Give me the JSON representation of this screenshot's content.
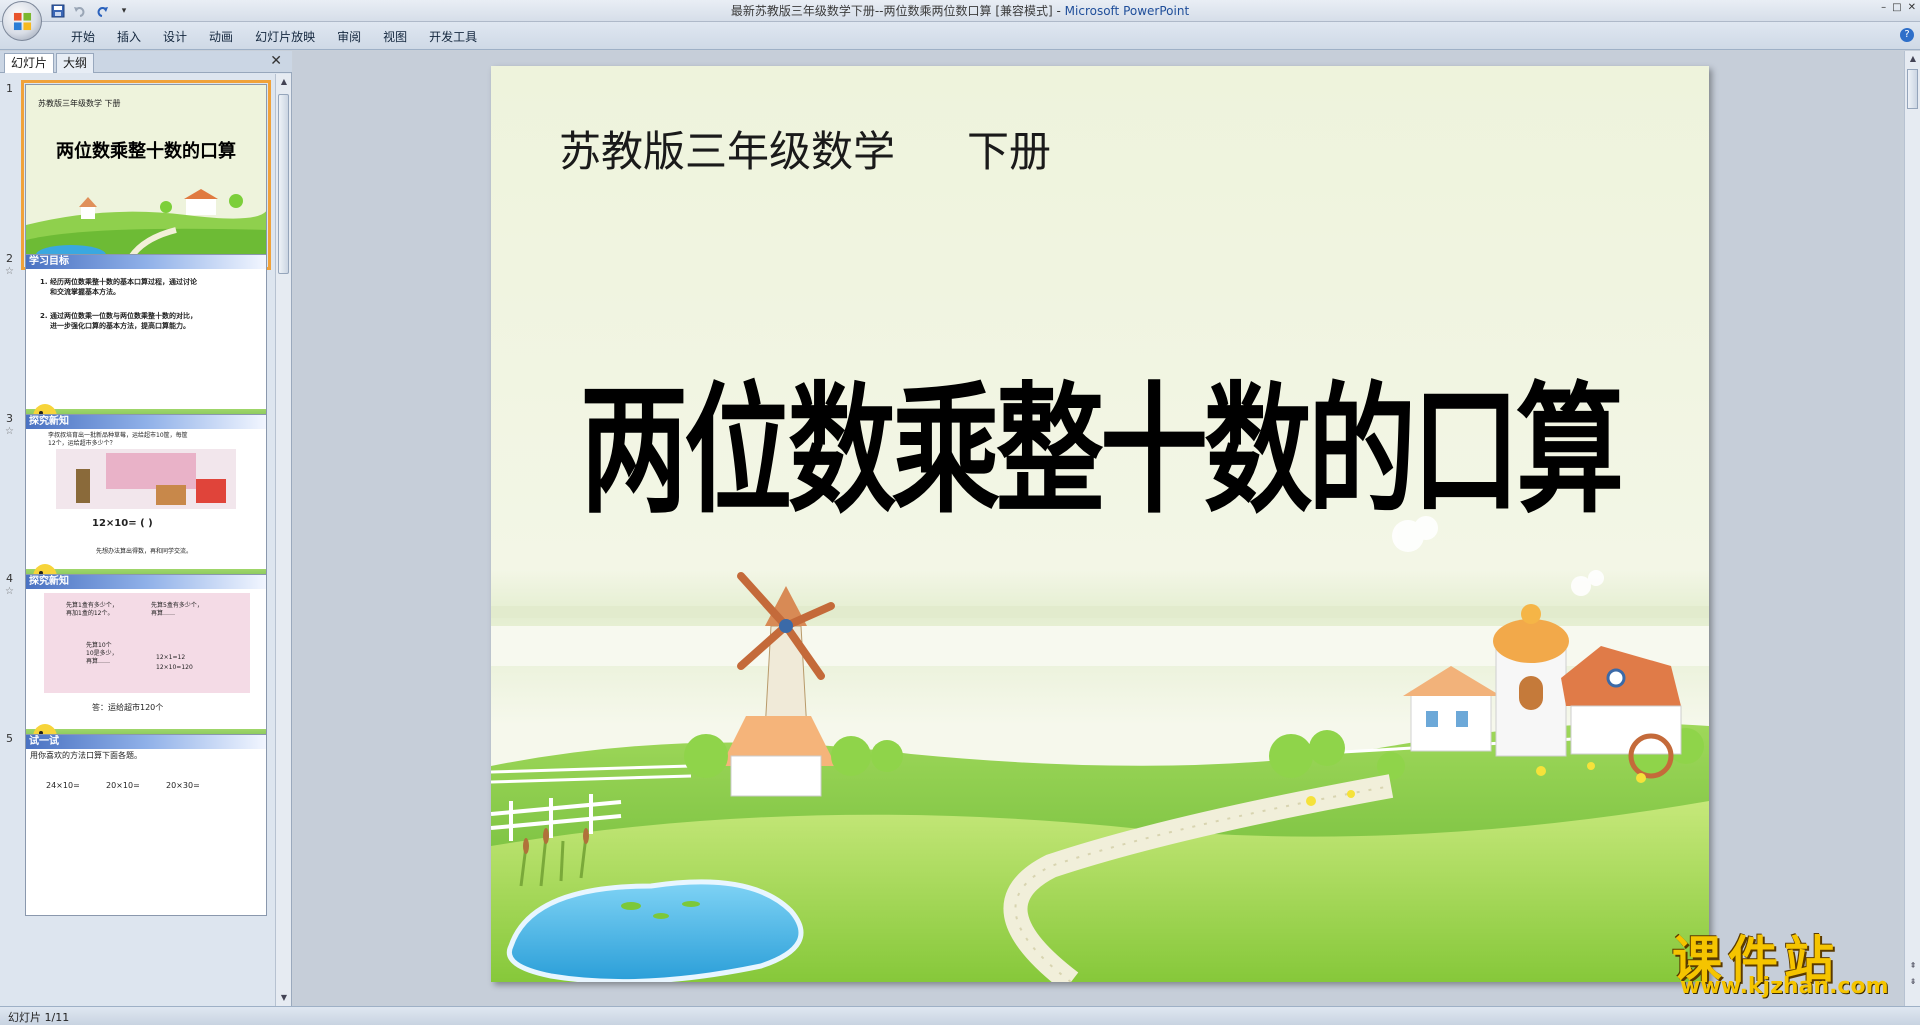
{
  "window": {
    "title_doc": "最新苏教版三年级数学下册--两位数乘两位数口算 [兼容模式]",
    "title_sep": " - ",
    "title_app": "Microsoft PowerPoint",
    "controls": [
      "–",
      "□",
      "✕"
    ]
  },
  "quick_access": [
    {
      "name": "save-icon",
      "glyph": "💾"
    },
    {
      "name": "undo-icon",
      "glyph": "↶"
    },
    {
      "name": "redo-icon",
      "glyph": "↻"
    },
    {
      "name": "customize-icon",
      "glyph": "▾"
    }
  ],
  "ribbon": {
    "tabs": [
      "开始",
      "插入",
      "设计",
      "动画",
      "幻灯片放映",
      "审阅",
      "视图",
      "开发工具"
    ],
    "help": "?"
  },
  "left_pane": {
    "tab_slides": "幻灯片",
    "tab_outline": "大纲",
    "close": "✕",
    "thumbnails": [
      {
        "num": "1",
        "subtitle": "苏教版三年级数学      下册",
        "title": "两位数乘整十数的口算"
      },
      {
        "num": "2",
        "header": "学习目标",
        "lines": [
          "1.  经历两位数乘整十数的基本口算过程，通过讨论",
          "和交流掌握基本方法。",
          "2.  通过两位数乘一位数与两位数乘整十数的对比，",
          "进一步强化口算的基本方法，提高口算能力。"
        ]
      },
      {
        "num": "3",
        "header": "探究新知",
        "lines": [
          "李叔叔培育出一批新品种草莓，运给超市10筐，每筐",
          "12个，运给超市多少个？"
        ],
        "expr": "12×10=      (   )",
        "note": "先想办法算出得数，再和同学交流。"
      },
      {
        "num": "4",
        "header": "探究新知",
        "lines": [
          "先算1盒有多少个，",
          "再加1盒的12个。",
          "先算5盒有多少个，",
          "再算……",
          "先算10个",
          "10是多少，",
          "再算……",
          "12×1=12",
          "12×10=120"
        ],
        "answer": "答：运给超市120个"
      },
      {
        "num": "5",
        "header": "试一试",
        "lines": [
          "用你喜欢的方法口算下面各题。"
        ],
        "exprs": [
          "24×10=",
          "20×10=",
          "20×30="
        ]
      }
    ]
  },
  "slide": {
    "subtitle_left": "苏教版三年级数学",
    "subtitle_right": "下册",
    "title": "两位数乘整十数的口算"
  },
  "watermark": {
    "text": "课件站",
    "url": "www.kjzhan.com"
  },
  "status": {
    "text": "幻灯片 1/11"
  },
  "colors": {
    "slide_bg": "#eef3dc",
    "grass": "#7cc43a",
    "pond": "#3aa8e0",
    "accent_selection": "#f0a23a",
    "watermark": "#f5c400"
  }
}
